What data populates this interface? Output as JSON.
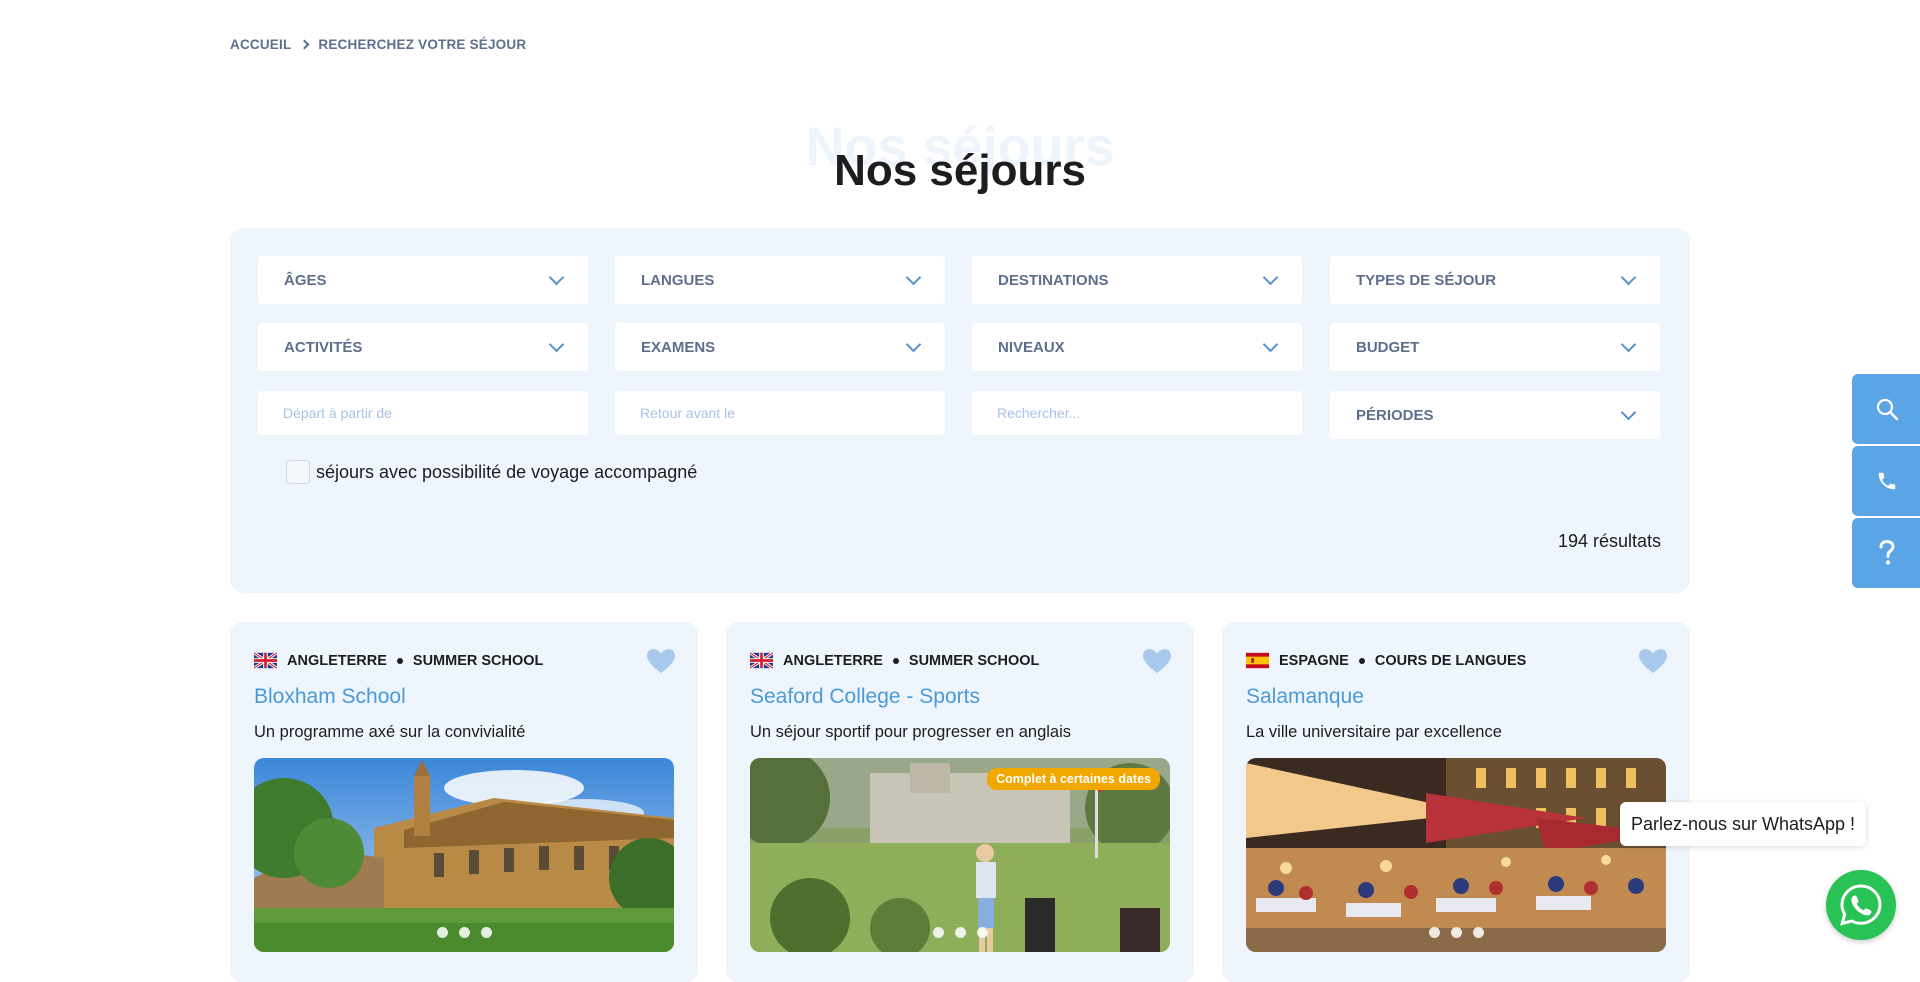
{
  "breadcrumb": {
    "home": "ACCUEIL",
    "current": "RECHERCHEZ VOTRE SÉJOUR"
  },
  "page": {
    "title_ghost": "Nos séjours",
    "title": "Nos séjours"
  },
  "filters": {
    "selects": [
      "ÂGES",
      "LANGUES",
      "DESTINATIONS",
      "TYPES DE SÉJOUR",
      "ACTIVITÉS",
      "EXAMENS",
      "NIVEAUX",
      "BUDGET"
    ],
    "depart_placeholder": "Départ à partir de",
    "retour_placeholder": "Retour avant le",
    "search_placeholder": "Rechercher...",
    "periodes_label": "PÉRIODES",
    "accompanied_label": "séjours avec possibilité de voyage accompagné",
    "results_count": "194 résultats"
  },
  "cards": [
    {
      "country": "ANGLETERRE",
      "type": "SUMMER SCHOOL",
      "title": "Bloxham School",
      "subtitle": "Un programme axé sur la convivialité",
      "flag": "uk-flag-icon"
    },
    {
      "country": "ANGLETERRE",
      "type": "SUMMER SCHOOL",
      "title": "Seaford College - Sports",
      "subtitle": "Un séjour sportif pour progresser en anglais",
      "badge": "Complet à certaines dates",
      "flag": "uk-flag-icon"
    },
    {
      "country": "ESPAGNE",
      "type": "COURS DE LANGUES",
      "title": "Salamanque",
      "subtitle": "La ville universitaire par excellence",
      "flag": "spain-flag-icon"
    }
  ],
  "whatsapp": {
    "bubble": "Parlez-nous sur WhatsApp !"
  },
  "colors": {
    "accent": "#5ba4e6",
    "panel": "#eff5fc",
    "link": "#4a9ad8",
    "badge": "#f0a700",
    "whatsapp": "#29c254"
  }
}
